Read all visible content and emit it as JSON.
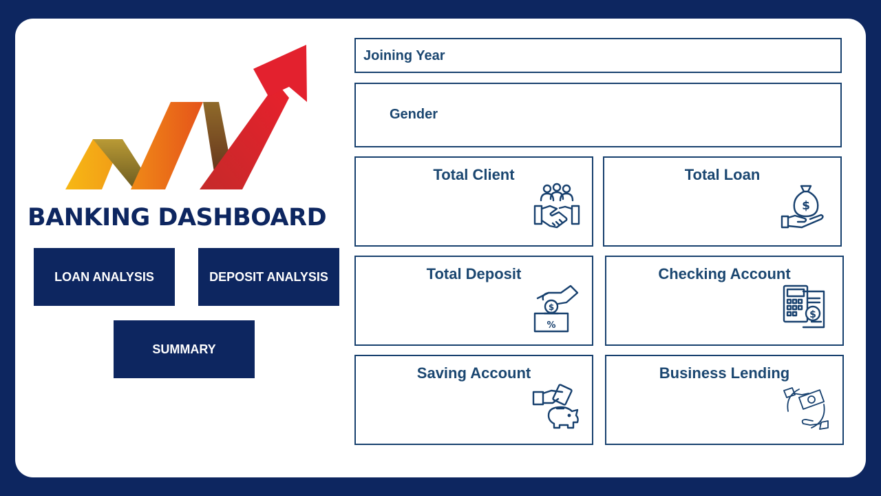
{
  "dashboard": {
    "title": "BANKING DASHBOARD",
    "colors": {
      "background": "#0d2660",
      "card": "#ffffff",
      "accent": "#17406e",
      "arrow_yellow": "#f5b316",
      "arrow_red": "#d81f2a"
    }
  },
  "nav": {
    "loan_analysis": "LOAN ANALYSIS",
    "deposit_analysis": "DEPOSIT ANALYSIS",
    "summary": "SUMMARY"
  },
  "filters": {
    "joining_year": "Joining Year",
    "gender": "Gender"
  },
  "kpis": {
    "total_client": {
      "label": "Total Client",
      "icon": "handshake-clients-icon"
    },
    "total_loan": {
      "label": "Total Loan",
      "icon": "money-bag-hand-icon"
    },
    "total_deposit": {
      "label": "Total Deposit",
      "icon": "deposit-coin-icon"
    },
    "checking_account": {
      "label": "Checking Account",
      "icon": "calculator-dollar-icon"
    },
    "saving_account": {
      "label": "Saving Account",
      "icon": "piggy-bank-icon"
    },
    "business_lending": {
      "label": "Business Lending",
      "icon": "money-exchange-icon"
    }
  }
}
